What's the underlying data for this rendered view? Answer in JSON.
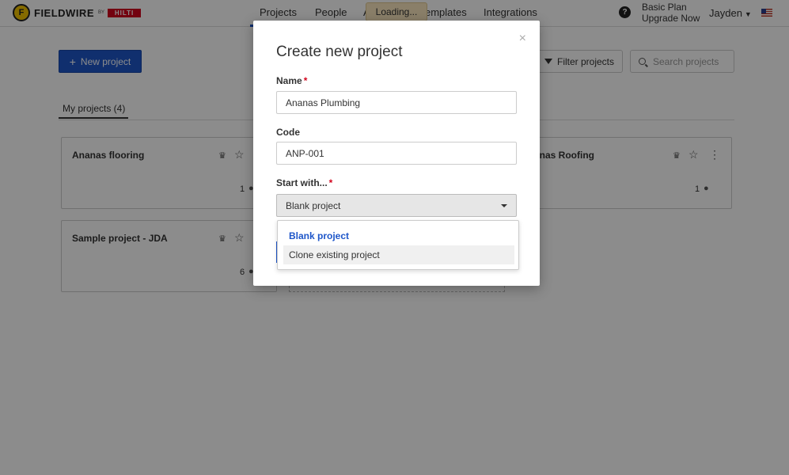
{
  "nav": {
    "logo_mark": "F",
    "logo_text": "FIELDWIRE",
    "logo_by": "BY",
    "logo_hilti": "HILTI",
    "items": [
      {
        "label": "Projects"
      },
      {
        "label": "People"
      },
      {
        "label": "A"
      },
      {
        "label": "emplates"
      },
      {
        "label": "Integrations"
      }
    ],
    "loading": "Loading...",
    "help": "?",
    "plan_line1": "Basic Plan",
    "plan_line2": "Upgrade Now",
    "user": "Jayden"
  },
  "toolbar": {
    "new_project": "New project",
    "filter": "Filter projects",
    "search_placeholder": "Search projects"
  },
  "tabs": {
    "my_projects": "My projects (4)"
  },
  "cards": [
    {
      "title": "Ananas flooring",
      "members": "1"
    },
    {
      "title": "anas Roofing",
      "members": "1"
    },
    {
      "title": "Sample project - JDA",
      "members": "6"
    }
  ],
  "modal": {
    "title": "Create new project",
    "close": "×",
    "name_label": "Name",
    "name_value": "Ananas Plumbing",
    "code_label": "Code",
    "code_value": "ANP-001",
    "start_label": "Start with...",
    "start_value": "Blank project",
    "required_mark": "*",
    "options": [
      "Blank project",
      "Clone existing project"
    ]
  },
  "colors": {
    "accent": "#1e56c9",
    "required": "#d2051e",
    "overlay": "rgba(0,0,0,0.45)"
  }
}
